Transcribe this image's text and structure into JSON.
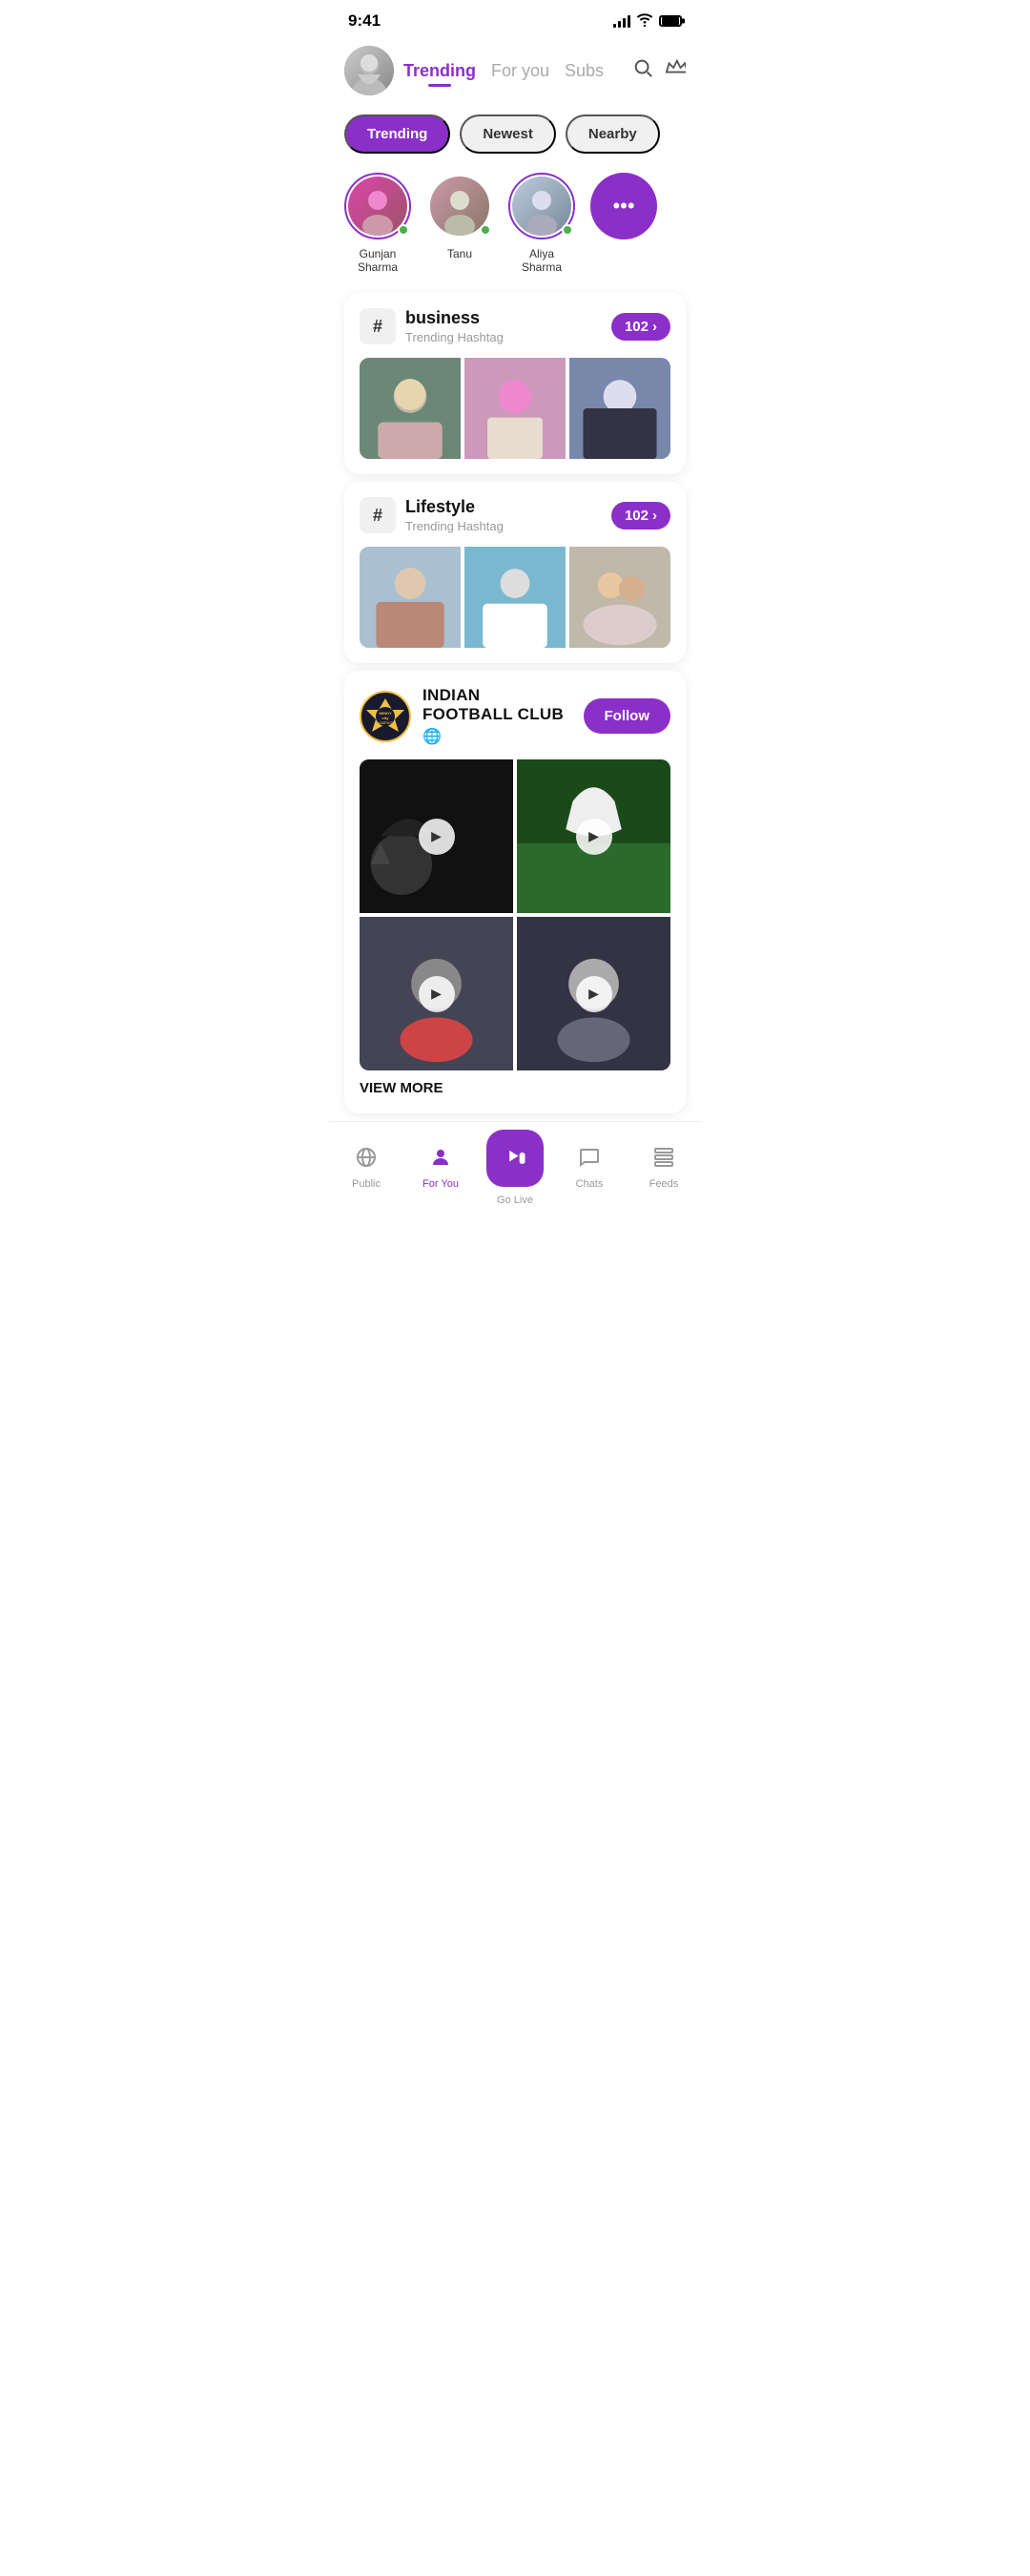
{
  "statusBar": {
    "time": "9:41",
    "signalBars": [
      4,
      7,
      9,
      11,
      13
    ],
    "wifi": true,
    "battery": true
  },
  "header": {
    "navTabs": [
      {
        "id": "trending",
        "label": "Trending",
        "active": true
      },
      {
        "id": "foryou",
        "label": "For you",
        "active": false
      },
      {
        "id": "subs",
        "label": "Subs",
        "active": false
      }
    ],
    "searchIcon": "🔍",
    "crownIcon": "👑"
  },
  "filterTabs": [
    {
      "id": "trending",
      "label": "Trending",
      "active": true
    },
    {
      "id": "newest",
      "label": "Newest",
      "active": false
    },
    {
      "id": "nearby",
      "label": "Nearby",
      "active": false
    }
  ],
  "stories": [
    {
      "id": "gunjan",
      "name": "Gunjan Sharma",
      "hasRing": true,
      "online": true,
      "color1": "#d4a",
      "color2": "#956"
    },
    {
      "id": "tanu",
      "name": "Tanu",
      "hasRing": false,
      "online": true,
      "color1": "#c9a",
      "color2": "#876"
    },
    {
      "id": "aliya",
      "name": "Aliya Sharma",
      "hasRing": true,
      "online": true,
      "color1": "#bcd",
      "color2": "#789"
    },
    {
      "id": "more",
      "name": "",
      "isMore": true
    }
  ],
  "hashtagCards": [
    {
      "id": "business",
      "tag": "business",
      "label": "Trending Hashtag",
      "count": "102",
      "images": [
        "img1",
        "img2",
        "img3"
      ]
    },
    {
      "id": "lifestyle",
      "tag": "Lifestyle",
      "label": "Trending Hashtag",
      "count": "102",
      "images": [
        "img4",
        "img5",
        "img6"
      ]
    }
  ],
  "footballClub": {
    "name": "INDIAN FOOTBALL CLUB",
    "logoText": "WINDY city",
    "globeIcon": "🌐",
    "followLabel": "Follow",
    "viewMoreLabel": "VIEW MORE"
  },
  "bottomNav": [
    {
      "id": "public",
      "label": "Public",
      "icon": "📡",
      "active": false
    },
    {
      "id": "foryou",
      "label": "For You",
      "icon": "👤",
      "active": true
    },
    {
      "id": "golive",
      "label": "Go Live",
      "icon": "🎥",
      "isCenter": true
    },
    {
      "id": "chats",
      "label": "Chats",
      "icon": "💬",
      "active": false
    },
    {
      "id": "feeds",
      "label": "Feeds",
      "icon": "📋",
      "active": false
    }
  ]
}
